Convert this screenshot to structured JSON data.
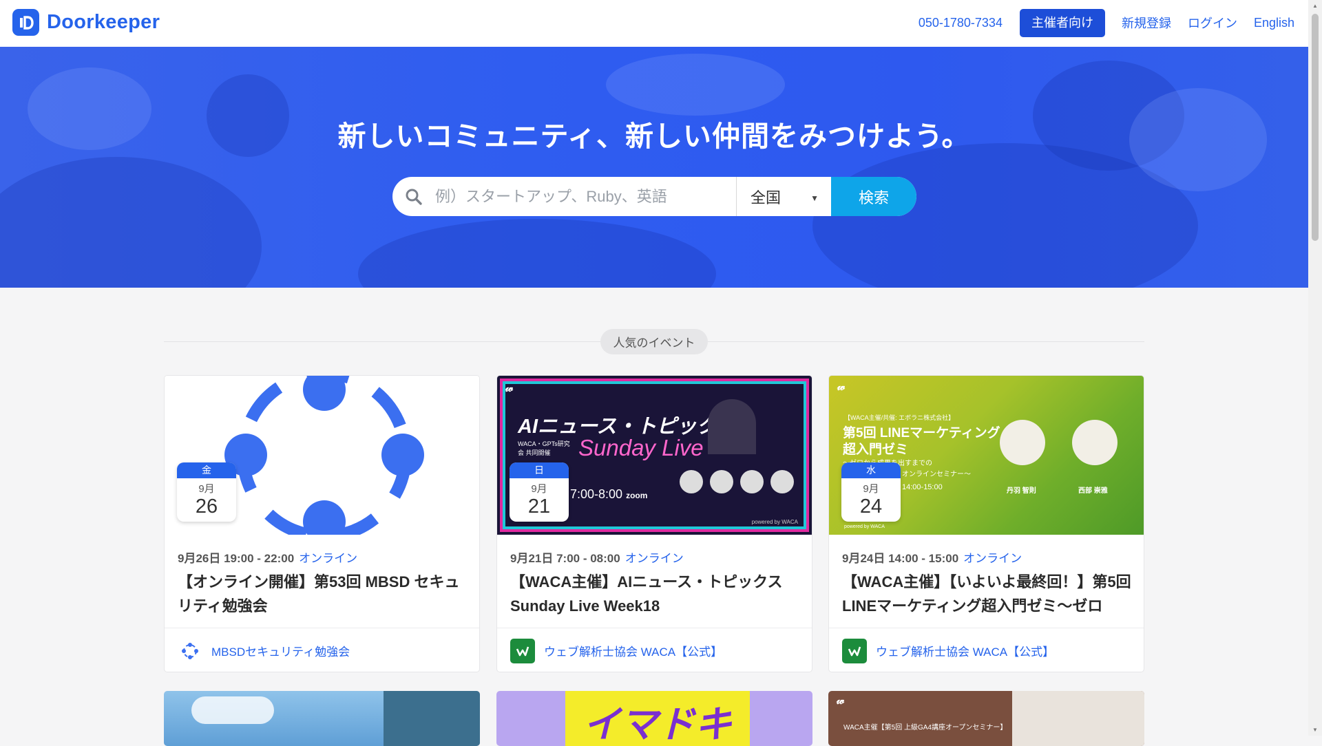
{
  "header": {
    "brand": "Doorkeeper",
    "phone": "050-1780-7334",
    "organizer_button": "主催者向け",
    "signup": "新規登録",
    "login": "ログイン",
    "language": "English"
  },
  "hero": {
    "title": "新しいコミュニティ、新しい仲間をみつけよう。",
    "search_placeholder": "例）スタートアップ、Ruby、英語",
    "region": "全国",
    "search_button": "検索"
  },
  "section": {
    "label": "人気のイベント"
  },
  "events": [
    {
      "dow": "金",
      "month": "9月",
      "day": "26",
      "time": "9月26日 19:00 - 22:00",
      "mode": "オンライン",
      "title": "【オンライン開催】第53回 MBSD セキュリティ勉強会",
      "organizer": "MBSDセキュリティ勉強会"
    },
    {
      "dow": "日",
      "month": "9月",
      "day": "21",
      "time": "9月21日 7:00 - 08:00",
      "mode": "オンライン",
      "title": "【WACA主催】AIニュース・トピックス Sunday Live Week18",
      "organizer": "ウェブ解析士協会 WACA【公式】",
      "banner": {
        "headline": "AIニュース・トピックス",
        "script": "Sunday Live",
        "sub": "WACA・GPTs研究会 共同開催",
        "time": "7:00-8:00",
        "zoom": "zoom",
        "powered": "powered by WACA"
      }
    },
    {
      "dow": "水",
      "month": "9月",
      "day": "24",
      "time": "9月24日 14:00 - 15:00",
      "mode": "オンライン",
      "title": "【WACA主催】【いよいよ最終回！】第5回 LINEマーケティング超入門ゼミ〜ゼロ",
      "organizer": "ウェブ解析士協会 WACA【公式】",
      "banner": {
        "top": "【WACA主催/共催: エボラニ株式会社】",
        "line1": "第5回 LINEマーケティング",
        "line2": "超入門ゼミ",
        "line3": "〜ゼロから成果を出すまでの",
        "line4": "オンラインセミナー〜",
        "time": "14:00-15:00",
        "speaker1": "丹羽 智則",
        "speaker2": "西部 崇雅",
        "powered": "powered by WACA"
      }
    }
  ],
  "next_row": {
    "card2_text": "イマドキ",
    "card3_text": "WACA主催【第5回 上級GA4講座オープンセミナー】"
  },
  "colors": {
    "brand": "#2563eb",
    "hero": "#2f5df0",
    "search_button": "#0ea5e9",
    "waca_green": "#1c8c3c"
  }
}
